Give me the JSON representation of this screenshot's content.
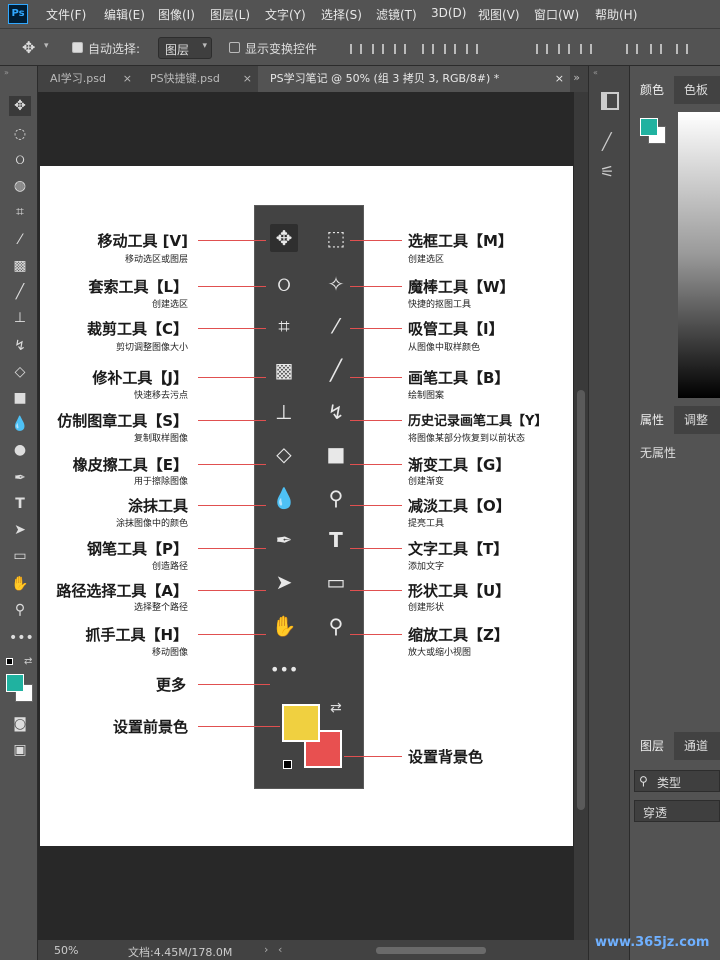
{
  "app": {
    "logo": "Ps"
  },
  "menu": [
    "文件(F)",
    "编辑(E)",
    "图像(I)",
    "图层(L)",
    "文字(Y)",
    "选择(S)",
    "滤镜(T)",
    "3D(D)",
    "视图(V)",
    "窗口(W)",
    "帮助(H)"
  ],
  "options": {
    "auto_select_label": "自动选择:",
    "auto_select_value": "图层",
    "show_transform_label": "显示变换控件"
  },
  "tabs": [
    {
      "label": "AI学习.psd"
    },
    {
      "label": "PS快捷键.psd"
    },
    {
      "label": "PS学习笔记 @ 50% (组 3 拷贝 3, RGB/8#) *"
    }
  ],
  "status": {
    "zoom": "50%",
    "doc": "文档:4.45M/178.0M"
  },
  "right_panels": {
    "color_tabs": [
      "颜色",
      "色板"
    ],
    "properties_tabs": [
      "属性",
      "调整"
    ],
    "no_properties": "无属性",
    "layers_tabs": [
      "图层",
      "通道"
    ],
    "layers_search": "类型",
    "blend_mode": "穿透"
  },
  "colors": {
    "foreground": "#20b2a0",
    "background": "#ffffff",
    "ref_fg": "#f0d040",
    "ref_bg": "#e85050",
    "pointer_lines": "#e05050"
  },
  "left_labels": [
    {
      "title": "移动工具 [V]",
      "sub": "移动选区或图层"
    },
    {
      "title": "套索工具【L】",
      "sub": "创建选区"
    },
    {
      "title": "裁剪工具【C】",
      "sub": "剪切调整图像大小"
    },
    {
      "title": "修补工具【J】",
      "sub": "快速移去污点"
    },
    {
      "title": "仿制图章工具【S】",
      "sub": "复制取样图像"
    },
    {
      "title": "橡皮擦工具【E】",
      "sub": "用于擦除图像"
    },
    {
      "title": "涂抹工具",
      "sub": "涂抹图像中的颜色"
    },
    {
      "title": "钢笔工具【P】",
      "sub": "创造路径"
    },
    {
      "title": "路径选择工具【A】",
      "sub": "选择整个路径"
    },
    {
      "title": "抓手工具【H】",
      "sub": "移动图像"
    },
    {
      "title": "更多",
      "sub": ""
    },
    {
      "title": "设置前景色",
      "sub": ""
    }
  ],
  "right_labels": [
    {
      "title": "选框工具【M】",
      "sub": "创建选区"
    },
    {
      "title": "魔棒工具【W】",
      "sub": "快捷的抠图工具"
    },
    {
      "title": "吸管工具【I】",
      "sub": "从图像中取样颜色"
    },
    {
      "title": "画笔工具【B】",
      "sub": "绘制图案"
    },
    {
      "title": "历史记录画笔工具【Y】",
      "sub": "将图像某部分恢复到以前状态"
    },
    {
      "title": "渐变工具【G】",
      "sub": "创建渐变"
    },
    {
      "title": "减淡工具【O】",
      "sub": "提亮工具"
    },
    {
      "title": "文字工具【T】",
      "sub": "添加文字"
    },
    {
      "title": "形状工具【U】",
      "sub": "创建形状"
    },
    {
      "title": "缩放工具【Z】",
      "sub": "放大或缩小视图"
    },
    {
      "title": "设置背景色",
      "sub": ""
    }
  ],
  "watermark": "www.365jz.com"
}
